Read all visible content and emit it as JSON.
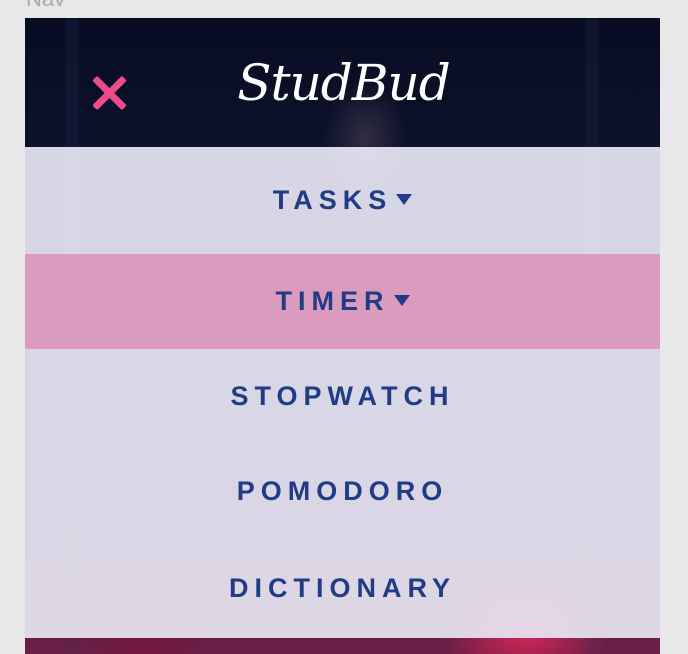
{
  "artboard": {
    "label": "Nav"
  },
  "header": {
    "brand": "StudBud"
  },
  "menu": {
    "items": [
      {
        "label": "TASKS",
        "has_caret": true
      },
      {
        "label": "TIMER",
        "has_caret": true,
        "active": true
      },
      {
        "label": "STOPWATCH",
        "has_caret": false
      },
      {
        "label": "POMODORO",
        "has_caret": false
      },
      {
        "label": "DICTIONARY",
        "has_caret": false
      }
    ]
  },
  "colors": {
    "accent_pink": "#ec4c8a",
    "menu_text": "#213c85",
    "menu_bg": "#e8e6f2",
    "menu_active_bg": "#e8a5c8",
    "header_text": "#ffffff"
  },
  "icons": {
    "close": "close-icon",
    "caret": "caret-down-icon"
  }
}
